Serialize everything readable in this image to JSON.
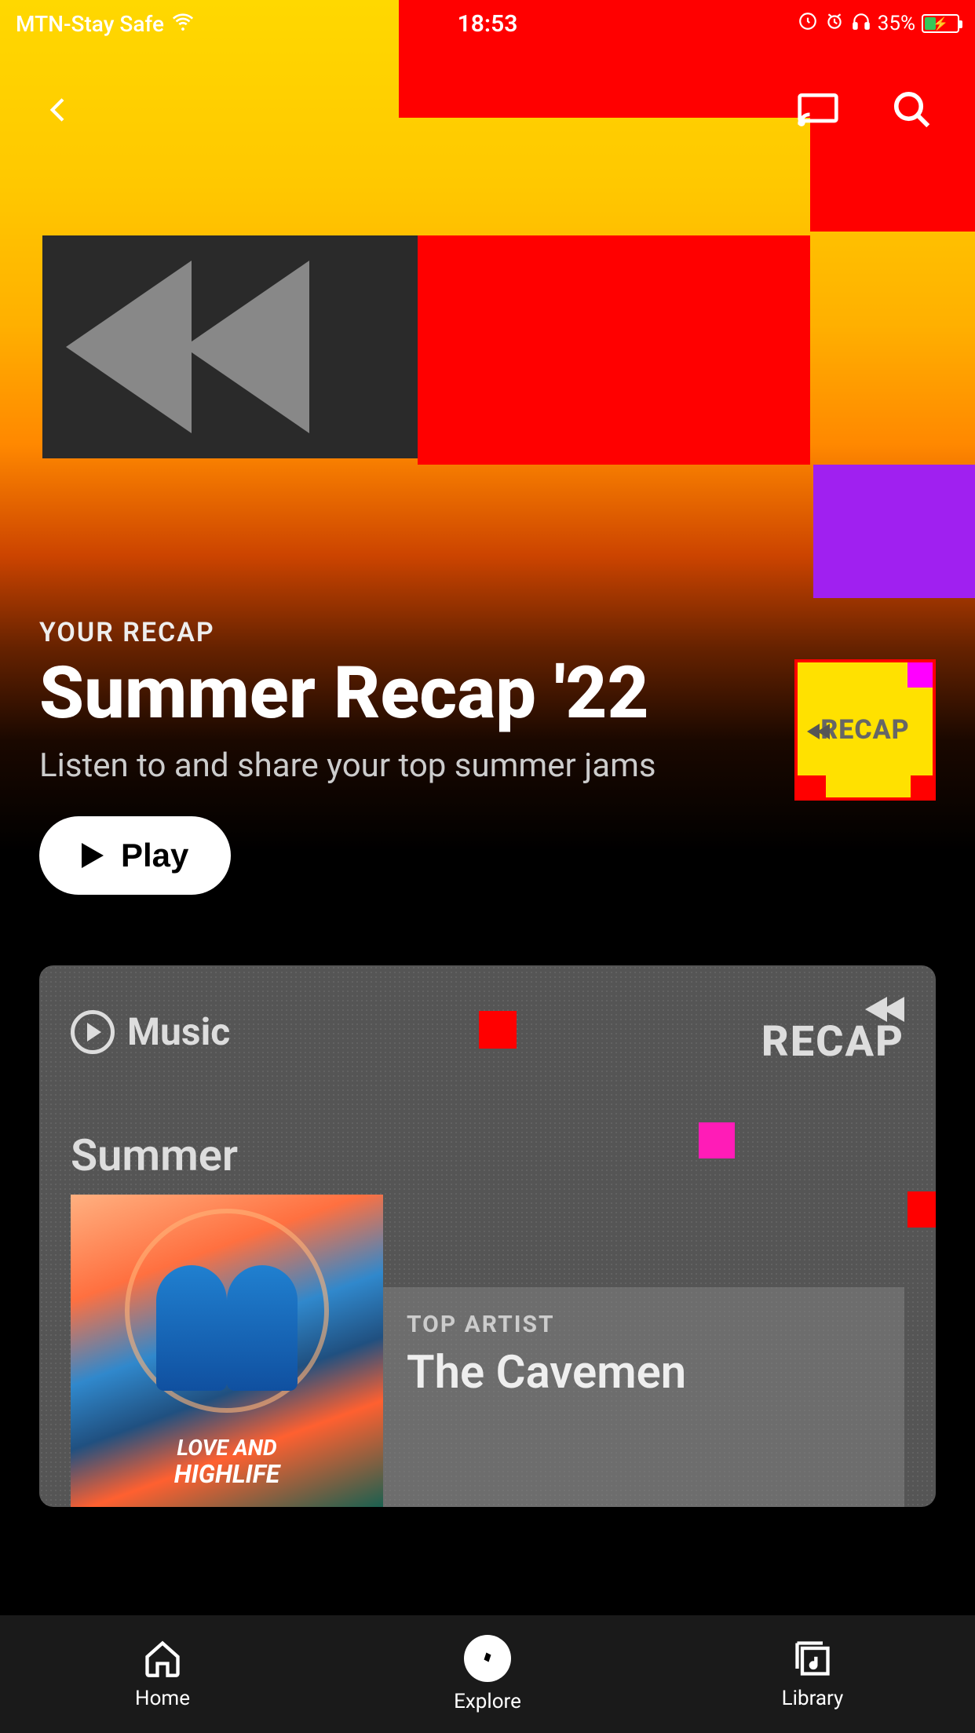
{
  "status": {
    "carrier": "MTN-Stay Safe",
    "time": "18:53",
    "battery_pct": "35%",
    "battery_level": 35
  },
  "hero": {
    "eyebrow": "YOUR RECAP",
    "title": "Summer Recap '22",
    "subtitle": "Listen to and share your top summer jams",
    "play_label": "Play",
    "thumb_label": "RECAP"
  },
  "card": {
    "music_label": "Music",
    "recap_label": "RECAP",
    "season": "Summer",
    "album_title_line1": "LOVE AND",
    "album_title_line2": "HIGHLIFE",
    "artist_label": "TOP ARTIST",
    "artist_name": "The Cavemen"
  },
  "nav": {
    "home": "Home",
    "explore": "Explore",
    "library": "Library"
  }
}
